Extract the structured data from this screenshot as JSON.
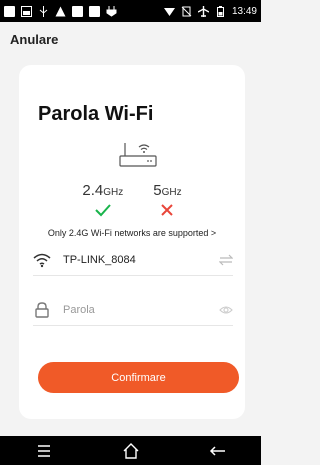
{
  "status_bar": {
    "time": "13:49"
  },
  "header": {
    "cancel_label": "Anulare"
  },
  "card": {
    "title": "Parola Wi-Fi",
    "bands": [
      {
        "main": "2.4",
        "unit": "GHz",
        "supported": true
      },
      {
        "main": "5",
        "unit": "GHz",
        "supported": false
      }
    ],
    "note": "Only 2.4G Wi-Fi networks are supported >",
    "network_name": "TP-LINK_8084",
    "password_placeholder": "Parola",
    "confirm_label": "Confirmare"
  },
  "colors": {
    "accent": "#f05a28",
    "check": "#19b44b",
    "cross": "#e8463a"
  }
}
